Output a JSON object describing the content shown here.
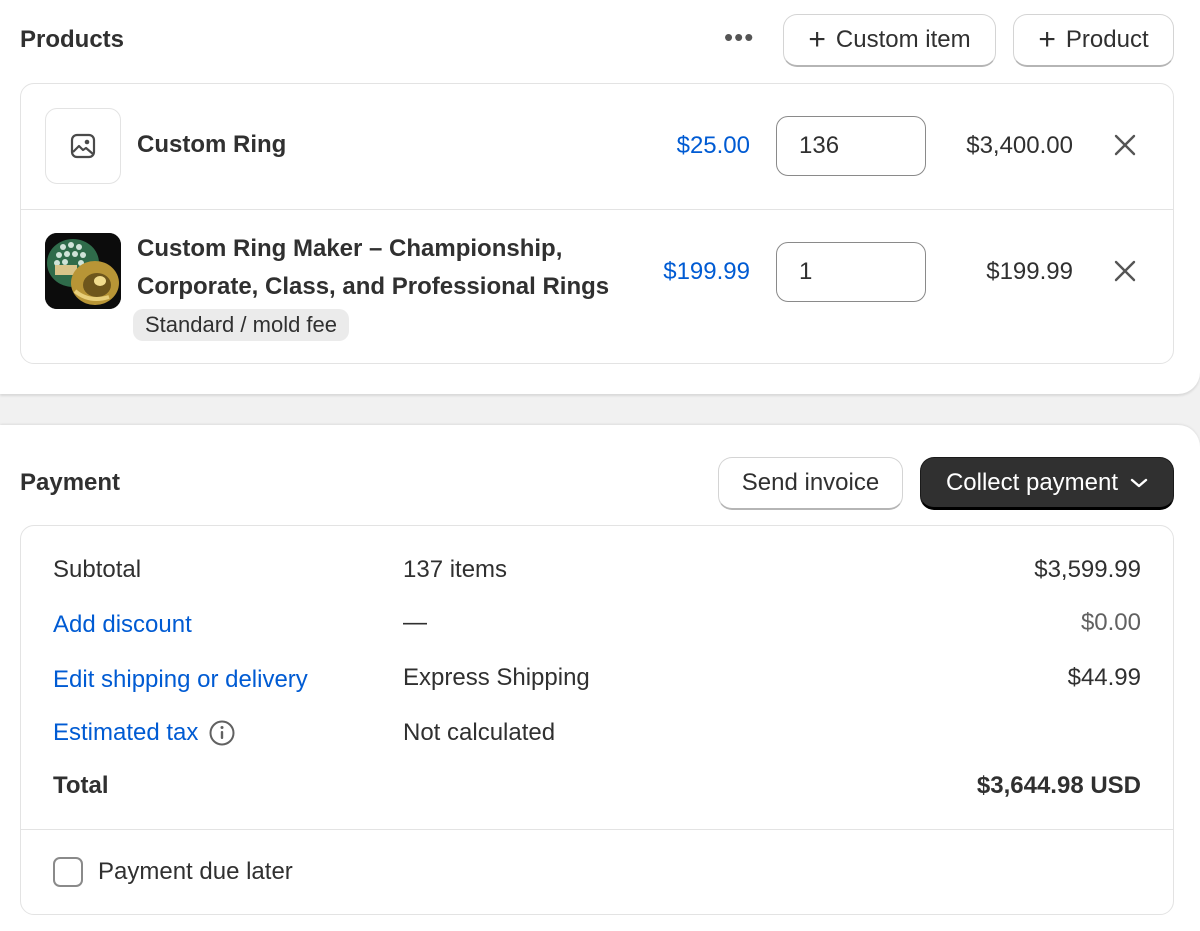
{
  "products": {
    "title": "Products",
    "more_icon": "more-horizontal-icon",
    "custom_item_label": "Custom item",
    "add_product_label": "Product",
    "items": [
      {
        "title": "Custom Ring",
        "price": "$25.00",
        "quantity": "136",
        "line_total": "$3,400.00",
        "image": "image-placeholder-icon"
      },
      {
        "title_line1": "Custom Ring Maker – Championship,",
        "title_line2": "Corporate, Class, and Professional Rings",
        "variant": "Standard / mold fee",
        "price": "$199.99",
        "quantity": "1",
        "line_total": "$199.99",
        "image": "championship-ring-thumbnail"
      }
    ]
  },
  "payment": {
    "title": "Payment",
    "send_invoice_label": "Send invoice",
    "collect_payment_label": "Collect payment",
    "rows": {
      "subtotal": {
        "label": "Subtotal",
        "detail": "137 items",
        "amount": "$3,599.99"
      },
      "discount": {
        "label": "Add discount",
        "detail": "—",
        "amount": "$0.00"
      },
      "shipping": {
        "label": "Edit shipping or delivery",
        "detail": "Express Shipping",
        "amount": "$44.99"
      },
      "tax": {
        "label": "Estimated tax",
        "detail": "Not calculated"
      },
      "total": {
        "label": "Total",
        "amount": "$3,644.98 USD"
      }
    },
    "payment_due_later_label": "Payment due later",
    "payment_due_later_checked": false
  },
  "colors": {
    "link": "#005bd3",
    "dark_button": "#303030",
    "text": "#303030",
    "border": "#e3e3e3",
    "page_background": "#f1f1f1"
  }
}
